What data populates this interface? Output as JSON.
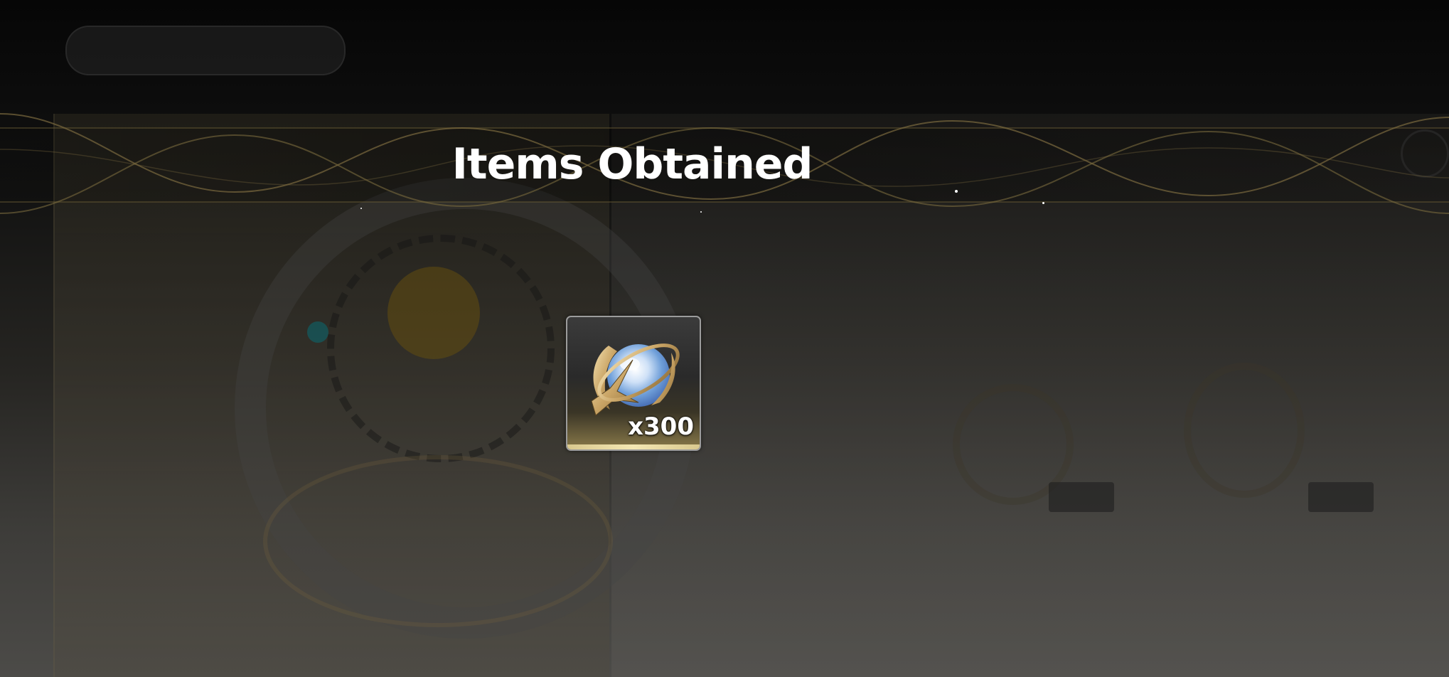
{
  "dialog": {
    "title": "Items Obtained",
    "items": [
      {
        "icon": "oneiric-shard-icon",
        "quantity_label": "x300"
      }
    ]
  },
  "colors": {
    "title_text": "#ffffff",
    "banner_line": "#7a6a3e",
    "card_border": "#9c9c9c",
    "card_accent": "#f4e7b3"
  }
}
